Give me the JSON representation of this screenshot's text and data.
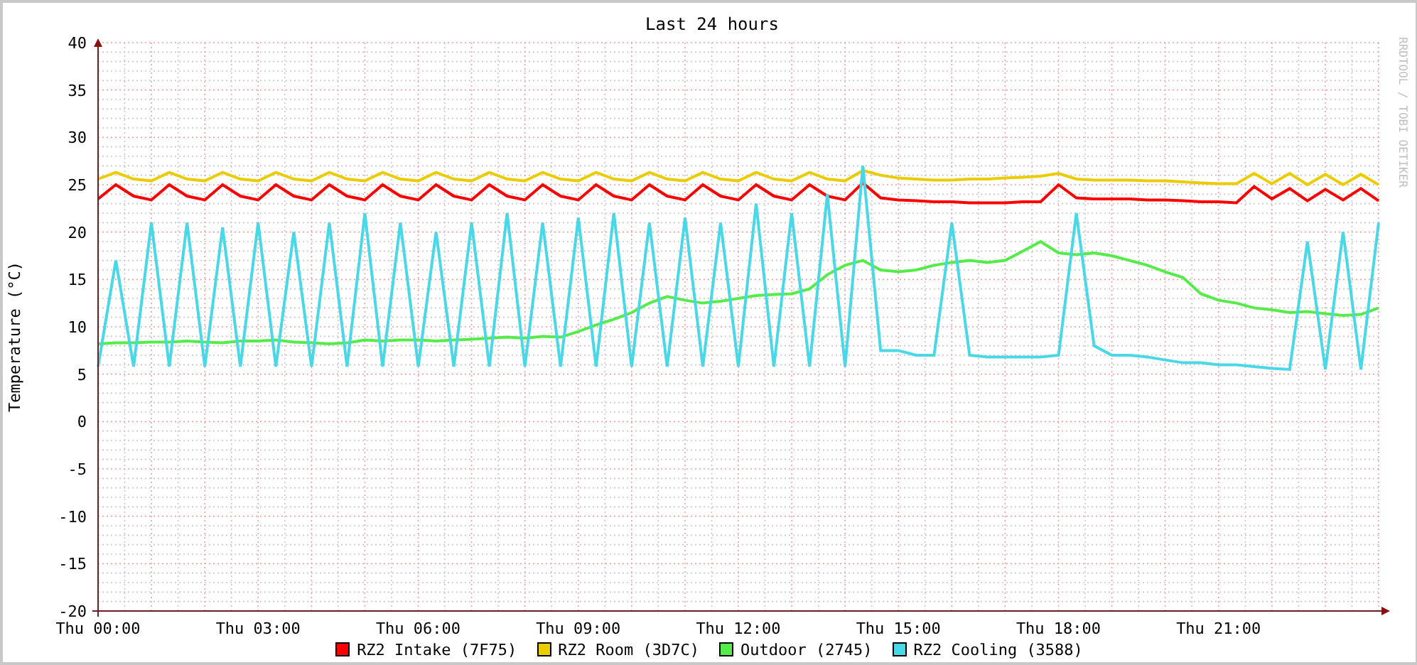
{
  "graph": {
    "credit": "RRDTOOL / TOBI OETIKER",
    "chart_data": {
      "type": "line",
      "grid": true,
      "title": "Last 24 hours",
      "ylabel": "Temperature (°C)",
      "ylim": [
        -20,
        40
      ],
      "yticks": [
        -20,
        -15,
        -10,
        -5,
        0,
        5,
        10,
        15,
        20,
        25,
        30,
        35,
        40
      ],
      "categories": [
        "Thu 00:00",
        null,
        null,
        null,
        null,
        null,
        null,
        null,
        null,
        "Thu 03:00",
        null,
        null,
        null,
        null,
        null,
        null,
        null,
        null,
        "Thu 06:00",
        null,
        null,
        null,
        null,
        null,
        null,
        null,
        null,
        "Thu 09:00",
        null,
        null,
        null,
        null,
        null,
        null,
        null,
        null,
        "Thu 12:00",
        null,
        null,
        null,
        null,
        null,
        null,
        null,
        null,
        "Thu 15:00",
        null,
        null,
        null,
        null,
        null,
        null,
        null,
        null,
        "Thu 18:00",
        null,
        null,
        null,
        null,
        null,
        null,
        null,
        null,
        "Thu 21:00",
        null,
        null,
        null,
        null,
        null,
        null,
        null,
        null,
        null
      ],
      "series": [
        {
          "name": "RZ2 Intake (7F75)",
          "color": "#ff0000",
          "values": [
            23.5,
            25,
            23.8,
            23.4,
            25,
            23.8,
            23.4,
            25,
            23.8,
            23.4,
            25,
            23.8,
            23.4,
            25,
            23.8,
            23.4,
            25,
            23.8,
            23.4,
            25,
            23.8,
            23.4,
            25,
            23.8,
            23.4,
            25,
            23.8,
            23.4,
            25,
            23.8,
            23.4,
            25,
            23.8,
            23.4,
            25,
            23.8,
            23.4,
            25,
            23.8,
            23.4,
            25,
            23.8,
            23.4,
            25.2,
            23.6,
            23.4,
            23.3,
            23.2,
            23.2,
            23.1,
            23.1,
            23.1,
            23.2,
            23.2,
            25,
            23.6,
            23.5,
            23.5,
            23.5,
            23.4,
            23.4,
            23.3,
            23.2,
            23.2,
            23.1,
            24.8,
            23.5,
            24.6,
            23.3,
            24.5,
            23.4,
            24.6,
            23.3
          ]
        },
        {
          "name": "RZ2 Room (3D7C)",
          "color": "#eacc00",
          "values": [
            25.6,
            26.3,
            25.6,
            25.4,
            26.3,
            25.6,
            25.4,
            26.3,
            25.6,
            25.4,
            26.3,
            25.6,
            25.4,
            26.3,
            25.6,
            25.4,
            26.3,
            25.6,
            25.4,
            26.3,
            25.6,
            25.4,
            26.3,
            25.6,
            25.4,
            26.3,
            25.6,
            25.4,
            26.3,
            25.6,
            25.4,
            26.3,
            25.6,
            25.4,
            26.3,
            25.6,
            25.4,
            26.3,
            25.6,
            25.4,
            26.3,
            25.6,
            25.4,
            26.5,
            26,
            25.7,
            25.6,
            25.5,
            25.5,
            25.6,
            25.6,
            25.7,
            25.8,
            25.9,
            26.2,
            25.6,
            25.5,
            25.5,
            25.5,
            25.4,
            25.4,
            25.3,
            25.2,
            25.1,
            25.1,
            26.2,
            25.1,
            26.2,
            25,
            26.1,
            25,
            26.1,
            25
          ]
        },
        {
          "name": "Outdoor (2745)",
          "color": "#54ec48",
          "values": [
            8.2,
            8.3,
            8.3,
            8.4,
            8.4,
            8.5,
            8.4,
            8.3,
            8.5,
            8.5,
            8.6,
            8.4,
            8.3,
            8.2,
            8.3,
            8.6,
            8.5,
            8.6,
            8.6,
            8.5,
            8.6,
            8.7,
            8.8,
            8.9,
            8.8,
            9,
            8.9,
            9.5,
            10.2,
            10.8,
            11.5,
            12.5,
            13.2,
            12.8,
            12.5,
            12.7,
            13,
            13.3,
            13.4,
            13.5,
            14,
            15.5,
            16.5,
            17,
            16,
            15.8,
            16,
            16.5,
            16.8,
            17,
            16.8,
            17,
            18,
            19,
            17.8,
            17.6,
            17.8,
            17.5,
            17,
            16.5,
            15.8,
            15.2,
            13.5,
            12.8,
            12.5,
            12,
            11.8,
            11.5,
            11.6,
            11.4,
            11.2,
            11.3,
            12
          ]
        },
        {
          "name": "RZ2 Cooling (3588)",
          "color": "#48d8e8",
          "values": [
            5.8,
            17,
            5.8,
            21,
            5.8,
            21,
            5.8,
            20.5,
            5.8,
            21,
            5.8,
            20,
            5.8,
            21,
            5.8,
            22,
            5.8,
            21,
            5.8,
            20,
            5.8,
            21,
            5.8,
            22,
            5.8,
            21,
            5.8,
            21.5,
            5.8,
            22,
            5.8,
            21,
            5.8,
            21.5,
            5.8,
            21,
            5.8,
            23,
            5.8,
            22,
            5.8,
            24,
            5.8,
            27,
            7.5,
            7.5,
            7,
            7,
            21,
            7,
            6.8,
            6.8,
            6.8,
            6.8,
            7,
            22,
            8,
            7,
            7,
            6.8,
            6.5,
            6.2,
            6.2,
            6,
            6,
            5.8,
            5.6,
            5.5,
            19,
            5.5,
            20,
            5.5,
            21
          ]
        }
      ]
    }
  }
}
